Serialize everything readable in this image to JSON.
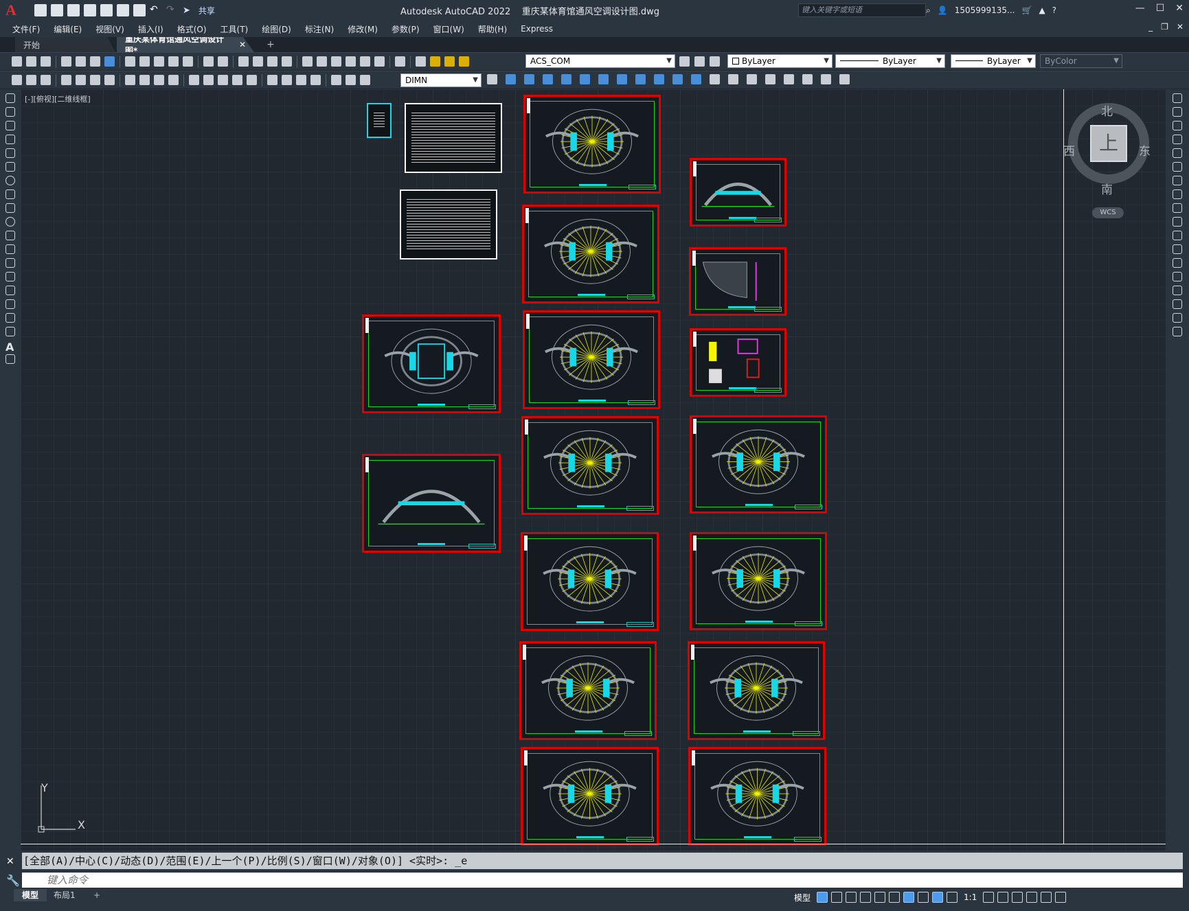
{
  "titlebar": {
    "app_name": "Autodesk AutoCAD 2022",
    "doc_name": "重庆某体育馆通风空调设计图.dwg",
    "share_label": "共享",
    "search_placeholder": "键入关键字或短语",
    "user": "1505999135...",
    "help": "?"
  },
  "menu": [
    "文件(F)",
    "编辑(E)",
    "视图(V)",
    "插入(I)",
    "格式(O)",
    "工具(T)",
    "绘图(D)",
    "标注(N)",
    "修改(M)",
    "参数(P)",
    "窗口(W)",
    "帮助(H)",
    "Express"
  ],
  "tabs": {
    "start": "开始",
    "doc": "重庆某体育馆通风空调设计图*",
    "close": "✕",
    "add": "+"
  },
  "toolbar": {
    "layer": "ACS_COM",
    "color": "ByLayer",
    "linetype": "ByLayer",
    "lineweight": "ByLayer",
    "plotstyle": "ByColor",
    "dimstyle": "DIMN"
  },
  "viewport": {
    "label": "[-][俯视][二维线框]",
    "wcs": "WCS",
    "compass": {
      "north": "北",
      "south": "南",
      "east": "东",
      "west": "西",
      "top": "上"
    },
    "ucs_x": "X",
    "ucs_y": "Y"
  },
  "command": {
    "history": "[全部(A)/中心(C)/动态(D)/范围(E)/上一个(P)/比例(S)/窗口(W)/对象(O)] <实时>: _e",
    "placeholder": "键入命令"
  },
  "status": {
    "model_tab": "模型",
    "layout_tab": "布局1",
    "add": "+",
    "model_label": "模型",
    "scale": "1:1"
  },
  "colors": {
    "frame": "#e00000",
    "accent": "#4d9bea",
    "canvas": "#212830"
  }
}
